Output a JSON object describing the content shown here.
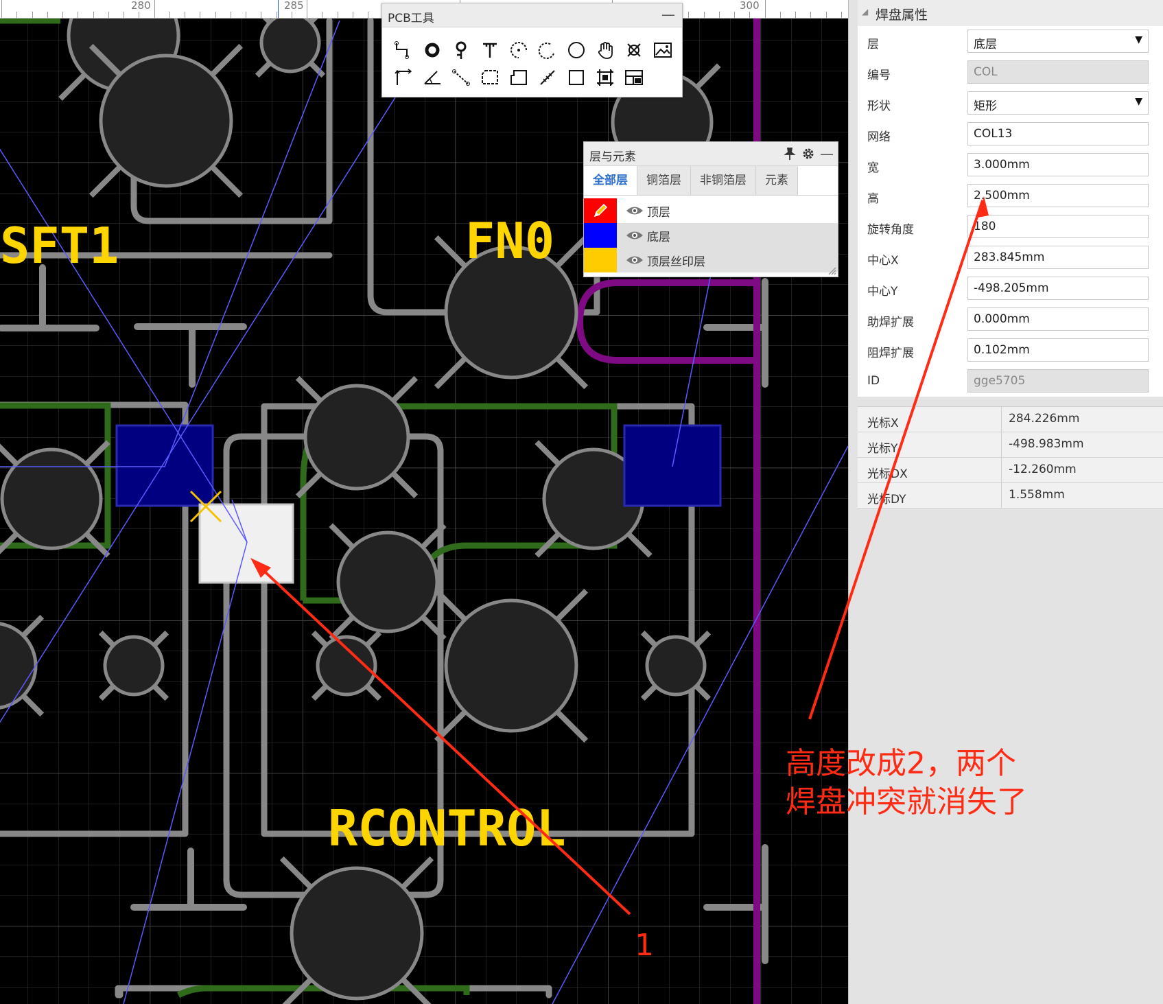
{
  "ruler": {
    "labels": [
      "280",
      "285",
      "300"
    ]
  },
  "pcb_tools": {
    "title": "PCB工具",
    "minimize": "—",
    "row1": [
      "wire-tool-icon",
      "pad-tool-icon",
      "via-tool-icon",
      "text-tool-icon",
      "arc-center-tool-icon",
      "arc-tool-icon",
      "circle-tool-icon",
      "pan-hand-icon",
      "cross-tool-icon",
      "image-tool-icon"
    ],
    "row2": [
      "dimension-tool-icon",
      "angle-tool-icon",
      "connect-tool-icon",
      "copper-area-tool-icon",
      "solid-region-tool-icon",
      "measure-tool-icon",
      "rectangle-tool-icon",
      "group-tool-icon",
      "canvas-tool-icon"
    ]
  },
  "pcb_labels": {
    "sft1": "SFT1",
    "fn0": "FN0",
    "rcontrol": "RCONTROL"
  },
  "layers_panel": {
    "title": "层与元素",
    "tabs": [
      "全部层",
      "铜箔层",
      "非铜箔层",
      "元素"
    ],
    "active_tab": "全部层",
    "rows": [
      {
        "name": "顶层",
        "color": "#ff0000",
        "selected": false,
        "editing": true
      },
      {
        "name": "底层",
        "color": "#0000ff",
        "selected": true,
        "editing": false
      },
      {
        "name": "顶层丝印层",
        "color": "#ffcc00",
        "selected": true,
        "editing": false
      }
    ]
  },
  "props": {
    "title": "焊盘属性",
    "rows": [
      {
        "label": "层",
        "value": "底层",
        "type": "select"
      },
      {
        "label": "编号",
        "value": "COL",
        "type": "readonly"
      },
      {
        "label": "形状",
        "value": "矩形",
        "type": "select"
      },
      {
        "label": "网络",
        "value": "COL13",
        "type": "input"
      },
      {
        "label": "宽",
        "value": "3.000mm",
        "type": "input"
      },
      {
        "label": "高",
        "value": "2.500mm",
        "type": "input"
      },
      {
        "label": "旋转角度",
        "value": "180",
        "type": "input"
      },
      {
        "label": "中心X",
        "value": "283.845mm",
        "type": "input"
      },
      {
        "label": "中心Y",
        "value": "-498.205mm",
        "type": "input"
      },
      {
        "label": "助焊扩展",
        "value": "0.000mm",
        "type": "input"
      },
      {
        "label": "阻焊扩展",
        "value": "0.102mm",
        "type": "input"
      },
      {
        "label": "ID",
        "value": "gge5705",
        "type": "readonly"
      }
    ],
    "cursor": [
      {
        "label": "光标X",
        "value": "284.226mm"
      },
      {
        "label": "光标Y",
        "value": "-498.983mm"
      },
      {
        "label": "光标DX",
        "value": "-12.260mm"
      },
      {
        "label": "光标DY",
        "value": "1.558mm"
      }
    ]
  },
  "annotations": {
    "note": "高度改成2，两个\n焊盘冲突就消失了",
    "marker": "1",
    "color": "#ff2b14"
  }
}
